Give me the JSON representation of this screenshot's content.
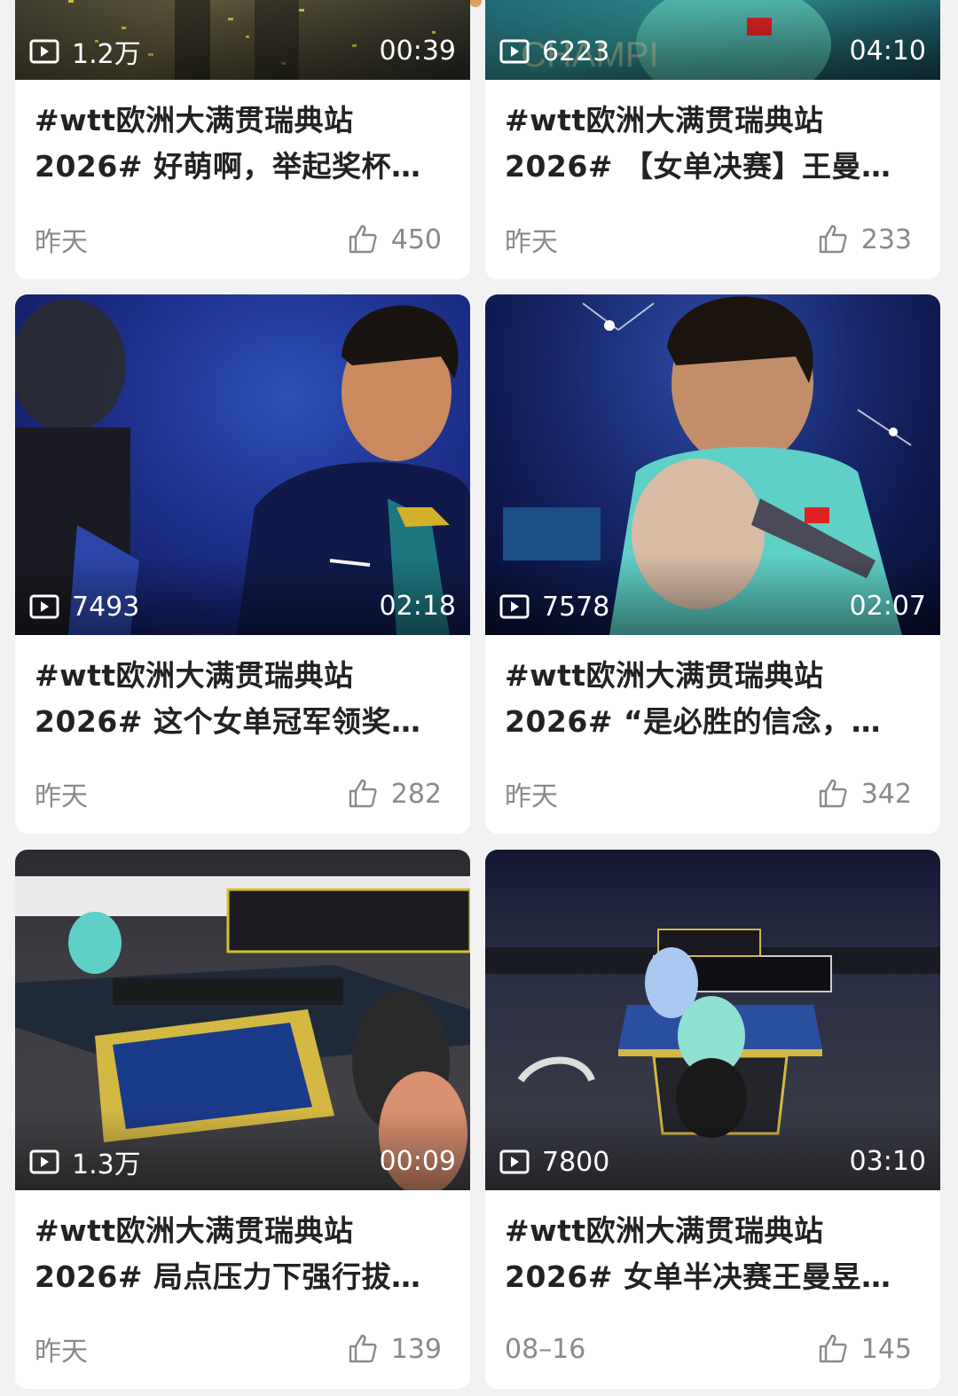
{
  "cards": [
    {
      "views": "1.2万",
      "duration": "00:39",
      "title1": "#wtt欧洲大满贯瑞典站",
      "title2": "2026# 好萌啊，举起奖杯…",
      "date": "昨天",
      "likes": "450"
    },
    {
      "views": "6223",
      "duration": "04:10",
      "title1": "#wtt欧洲大满贯瑞典站",
      "title2": "2026# 【女单决赛】王曼…",
      "date": "昨天",
      "likes": "233"
    },
    {
      "views": "7493",
      "duration": "02:18",
      "title1": "#wtt欧洲大满贯瑞典站",
      "title2": "2026# 这个女单冠军领奖…",
      "date": "昨天",
      "likes": "282"
    },
    {
      "views": "7578",
      "duration": "02:07",
      "title1": "#wtt欧洲大满贯瑞典站",
      "title2": "2026# “是必胜的信念，…",
      "date": "昨天",
      "likes": "342"
    },
    {
      "views": "1.3万",
      "duration": "00:09",
      "title1": "#wtt欧洲大满贯瑞典站",
      "title2": "2026# 局点压力下强行拔…",
      "date": "昨天",
      "likes": "139"
    },
    {
      "views": "7800",
      "duration": "03:10",
      "title1": "#wtt欧洲大满贯瑞典站",
      "title2": "2026# 女单半决赛王曼昱…",
      "date": "08–16",
      "likes": "145"
    }
  ]
}
